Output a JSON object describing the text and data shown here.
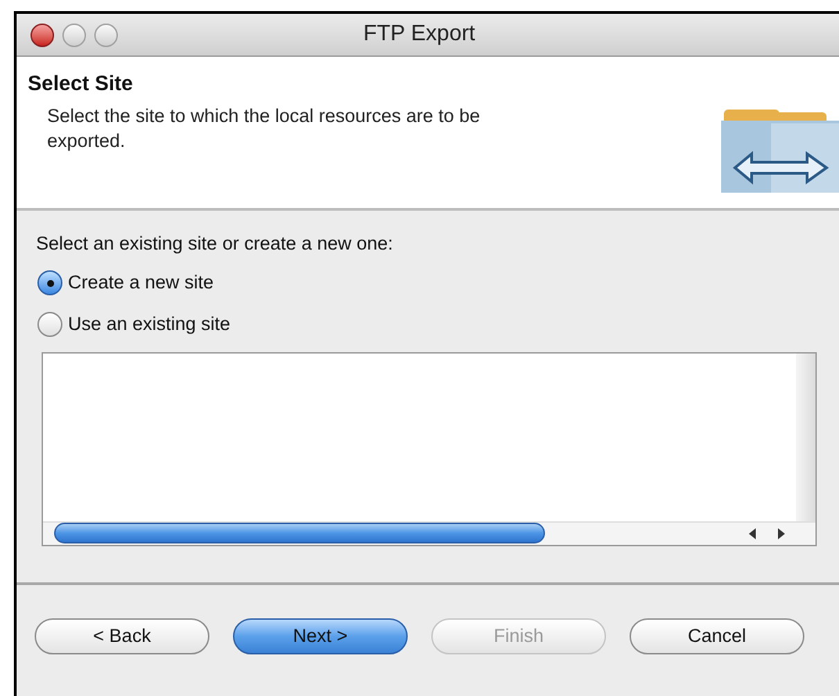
{
  "window": {
    "title": "FTP Export"
  },
  "header": {
    "title": "Select Site",
    "description": "Select the site to which the local resources are to be exported."
  },
  "prompt": "Select an existing site or create a new one:",
  "options": [
    {
      "label": "Create a new site",
      "selected": true
    },
    {
      "label": "Use an existing site",
      "selected": false
    }
  ],
  "buttons": [
    {
      "label": "< Back",
      "default": false,
      "disabled": false
    },
    {
      "label": "Next >",
      "default": true,
      "disabled": false
    },
    {
      "label": "Finish",
      "default": false,
      "disabled": true
    },
    {
      "label": "Cancel",
      "default": false,
      "disabled": false
    }
  ]
}
